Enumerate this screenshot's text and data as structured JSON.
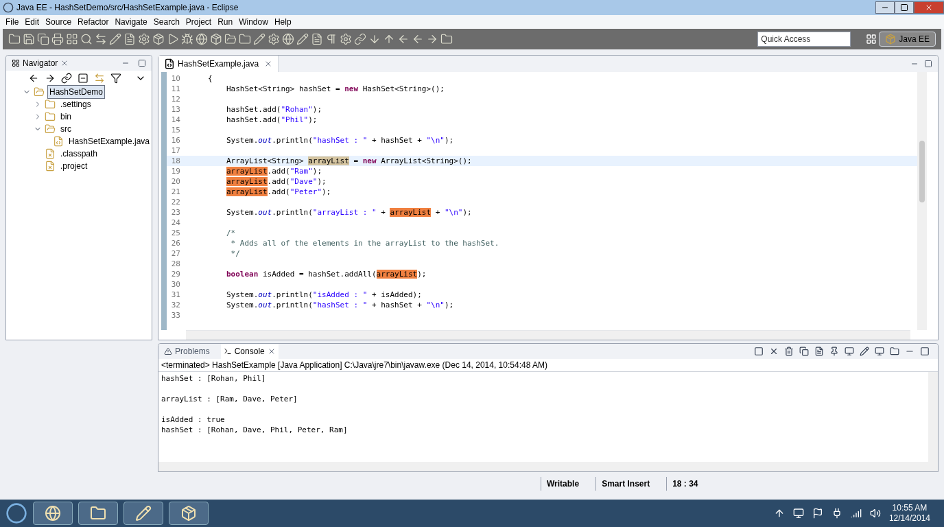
{
  "window": {
    "title": "Java EE - HashSetDemo/src/HashSetExample.java - Eclipse"
  },
  "menu": [
    "File",
    "Edit",
    "Source",
    "Refactor",
    "Navigate",
    "Search",
    "Project",
    "Run",
    "Window",
    "Help"
  ],
  "toolbar": {
    "quick_access": {
      "placeholder": "Quick Access"
    },
    "perspective": "Java EE"
  },
  "navigator": {
    "tab": "Navigator",
    "tree": [
      {
        "label": "HashSetDemo",
        "kind": "project",
        "selected": true,
        "expanded": true,
        "children": [
          {
            "label": ".settings",
            "kind": "folder",
            "selected": false,
            "expanded": false
          },
          {
            "label": "bin",
            "kind": "folder",
            "selected": false,
            "expanded": false
          },
          {
            "label": "src",
            "kind": "folder",
            "selected": false,
            "expanded": true,
            "children": [
              {
                "label": "HashSetExample.java",
                "kind": "java",
                "selected": false
              }
            ]
          },
          {
            "label": ".classpath",
            "kind": "xfile",
            "selected": false
          },
          {
            "label": ".project",
            "kind": "xfile",
            "selected": false
          }
        ]
      }
    ]
  },
  "editor": {
    "tab": "HashSetExample.java",
    "lines": [
      {
        "number": "10",
        "kind": "brace",
        "current": false,
        "segments": [
          {
            "kind": "plain",
            "text": "{"
          }
        ]
      },
      {
        "number": "11",
        "kind": "statement",
        "current": false,
        "segments": [
          {
            "kind": "plain",
            "text": "HashSet<String> hashSet = "
          },
          {
            "kind": "keyword",
            "text": "new"
          },
          {
            "kind": "plain",
            "text": " HashSet<String>();"
          }
        ]
      },
      {
        "number": "12",
        "current": false
      },
      {
        "number": "13",
        "kind": "statement",
        "current": false,
        "segments": [
          {
            "kind": "plain",
            "text": "hashSet.add("
          },
          {
            "kind": "string",
            "text": "\"Rohan\""
          },
          {
            "kind": "plain",
            "text": ");"
          }
        ]
      },
      {
        "number": "14",
        "kind": "statement",
        "current": false,
        "segments": [
          {
            "kind": "plain",
            "text": "hashSet.add("
          },
          {
            "kind": "string",
            "text": "\"Phil\""
          },
          {
            "kind": "plain",
            "text": ");"
          }
        ]
      },
      {
        "number": "15",
        "current": false
      },
      {
        "number": "16",
        "kind": "statement",
        "current": false,
        "segments": [
          {
            "kind": "plain",
            "text": "System."
          },
          {
            "kind": "field",
            "text": "out"
          },
          {
            "kind": "plain",
            "text": ".println("
          },
          {
            "kind": "string",
            "text": "\"hashSet : \""
          },
          {
            "kind": "plain",
            "text": " + hashSet + "
          },
          {
            "kind": "string",
            "text": "\"\\n\""
          },
          {
            "kind": "plain",
            "text": ");"
          }
        ]
      },
      {
        "number": "17",
        "current": false
      },
      {
        "number": "18",
        "kind": "statement",
        "current": true,
        "segments": [
          {
            "kind": "plain",
            "text": "ArrayList<String> "
          },
          {
            "kind": "declaration",
            "text": "arrayList"
          },
          {
            "kind": "plain",
            "text": " = "
          },
          {
            "kind": "keyword",
            "text": "new"
          },
          {
            "kind": "plain",
            "text": " ArrayList<String>();"
          }
        ]
      },
      {
        "number": "19",
        "kind": "statement",
        "current": false,
        "segments": [
          {
            "kind": "occurrence",
            "text": "arrayList"
          },
          {
            "kind": "plain",
            "text": ".add("
          },
          {
            "kind": "string",
            "text": "\"Ram\""
          },
          {
            "kind": "plain",
            "text": ");"
          }
        ]
      },
      {
        "number": "20",
        "kind": "statement",
        "current": false,
        "segments": [
          {
            "kind": "occurrence",
            "text": "arrayList"
          },
          {
            "kind": "plain",
            "text": ".add("
          },
          {
            "kind": "string",
            "text": "\"Dave\""
          },
          {
            "kind": "plain",
            "text": ");"
          }
        ]
      },
      {
        "number": "21",
        "kind": "statement",
        "current": false,
        "segments": [
          {
            "kind": "occurrence",
            "text": "arrayList"
          },
          {
            "kind": "plain",
            "text": ".add("
          },
          {
            "kind": "string",
            "text": "\"Peter\""
          },
          {
            "kind": "plain",
            "text": ");"
          }
        ]
      },
      {
        "number": "22",
        "current": false
      },
      {
        "number": "23",
        "kind": "statement",
        "current": false,
        "segments": [
          {
            "kind": "plain",
            "text": "System."
          },
          {
            "kind": "field",
            "text": "out"
          },
          {
            "kind": "plain",
            "text": ".println("
          },
          {
            "kind": "string",
            "text": "\"arrayList : \""
          },
          {
            "kind": "plain",
            "text": " + "
          },
          {
            "kind": "occurrence",
            "text": "arrayList"
          },
          {
            "kind": "plain",
            "text": " + "
          },
          {
            "kind": "string",
            "text": "\"\\n\""
          },
          {
            "kind": "plain",
            "text": ");"
          }
        ]
      },
      {
        "number": "24",
        "current": false
      },
      {
        "number": "25",
        "kind": "statement",
        "current": false,
        "segments": [
          {
            "kind": "comment",
            "text": "/*"
          }
        ]
      },
      {
        "number": "26",
        "kind": "statement",
        "current": false,
        "segments": [
          {
            "kind": "comment",
            "text": " * Adds all of the elements in the arrayList to the hashSet."
          }
        ]
      },
      {
        "number": "27",
        "kind": "statement",
        "current": false,
        "segments": [
          {
            "kind": "comment",
            "text": " */"
          }
        ]
      },
      {
        "number": "28",
        "current": false
      },
      {
        "number": "29",
        "kind": "statement",
        "current": false,
        "segments": [
          {
            "kind": "keyword",
            "text": "boolean"
          },
          {
            "kind": "plain",
            "text": " isAdded = hashSet.addAll("
          },
          {
            "kind": "occurrence",
            "text": "arrayList"
          },
          {
            "kind": "plain",
            "text": ");"
          }
        ]
      },
      {
        "number": "30",
        "current": false
      },
      {
        "number": "31",
        "kind": "statement",
        "current": false,
        "segments": [
          {
            "kind": "plain",
            "text": "System."
          },
          {
            "kind": "field",
            "text": "out"
          },
          {
            "kind": "plain",
            "text": ".println("
          },
          {
            "kind": "string",
            "text": "\"isAdded : \""
          },
          {
            "kind": "plain",
            "text": " + isAdded);"
          }
        ]
      },
      {
        "number": "32",
        "kind": "statement",
        "current": false,
        "segments": [
          {
            "kind": "plain",
            "text": "System."
          },
          {
            "kind": "field",
            "text": "out"
          },
          {
            "kind": "plain",
            "text": ".println("
          },
          {
            "kind": "string",
            "text": "\"hashSet : \""
          },
          {
            "kind": "plain",
            "text": " + hashSet + "
          },
          {
            "kind": "string",
            "text": "\"\\n\""
          },
          {
            "kind": "plain",
            "text": ");"
          }
        ]
      },
      {
        "number": "33",
        "current": false
      }
    ]
  },
  "console": {
    "tabs": [
      {
        "label": "Problems",
        "selected": false
      },
      {
        "label": "Console",
        "selected": true
      }
    ],
    "header": "<terminated> HashSetExample [Java Application] C:\\Java\\jre7\\bin\\javaw.exe (Dec 14, 2014, 10:54:48 AM)",
    "blocks": [
      [
        "hashSet : [Rohan, Phil]"
      ],
      [
        "arrayList : [Ram, Dave, Peter]"
      ],
      [
        "isAdded : true",
        "hashSet : [Rohan, Dave, Phil, Peter, Ram]"
      ]
    ]
  },
  "status_bar": [
    "Writable",
    "Smart Insert",
    "18 : 34"
  ],
  "taskbar": {
    "time": "10:55 AM",
    "date": "12/14/2014"
  }
}
